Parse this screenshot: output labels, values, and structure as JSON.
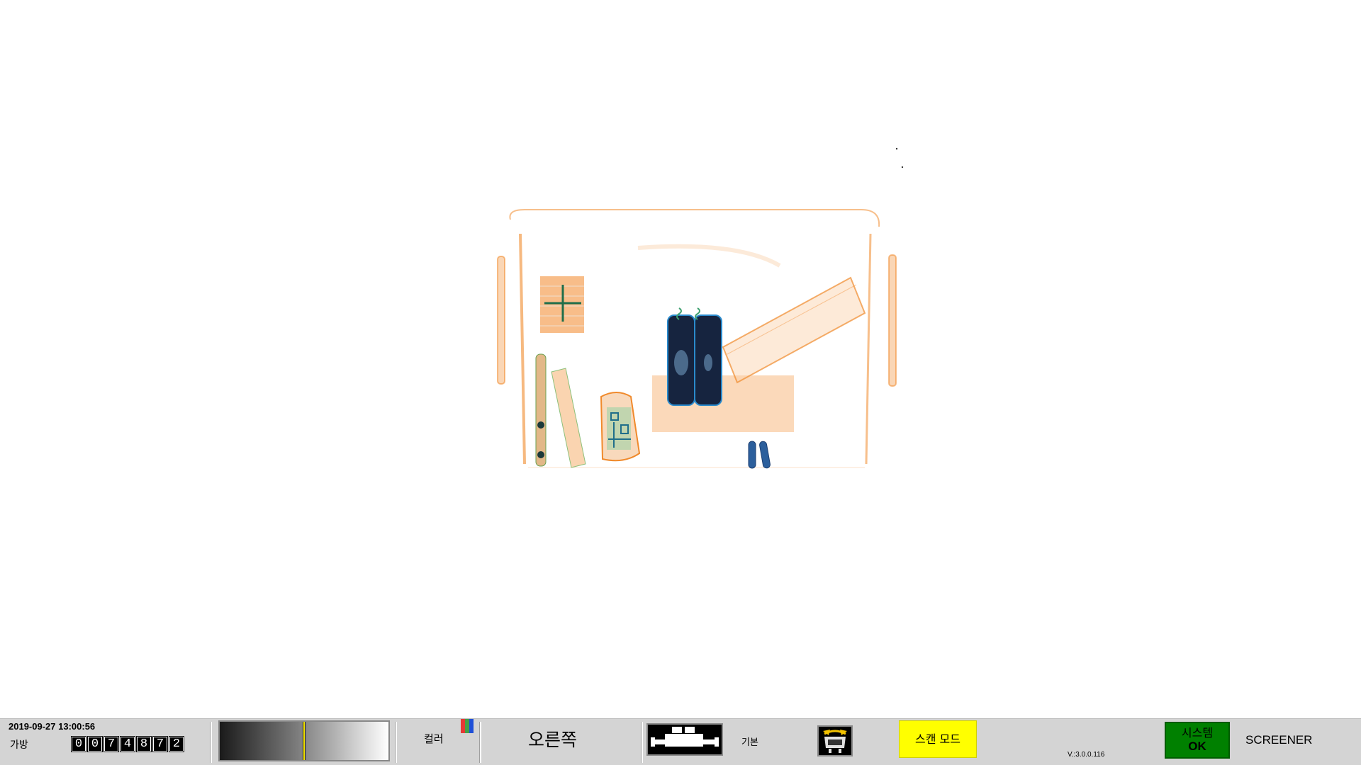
{
  "viewport": {
    "description_objects": [
      "suitcase-outline",
      "cable-spool",
      "metal-rod",
      "wooden-slat",
      "electronic-device",
      "battery-pair",
      "book",
      "zipper-pulls"
    ]
  },
  "status_bar": {
    "datetime": "2019-09-27 13:00:56",
    "bag_label": "가방",
    "bag_counter_digits": [
      "0",
      "0",
      "7",
      "4",
      "8",
      "7",
      "2"
    ],
    "grayscale_level": 0.5,
    "color_label": "컬러",
    "palette_colors": [
      "#e53935",
      "#43a047",
      "#1e4fd8"
    ],
    "direction_label": "오른쪽",
    "belt_icon": "conveyor-belt-icon",
    "basic_label": "기본",
    "edit_icon": "image-edit-icon",
    "scan_mode_label": "스캔 모드",
    "version": "V.:3.0.0.116",
    "system_label": "시스템",
    "system_status": "OK",
    "operator": "SCREENER"
  }
}
